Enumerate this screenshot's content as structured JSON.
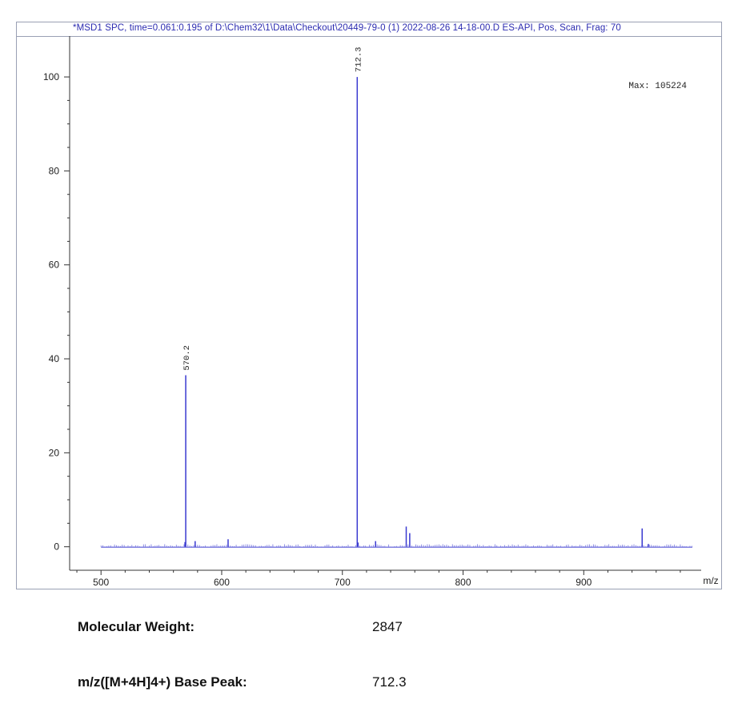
{
  "header": {
    "title": "*MSD1 SPC, time=0.061:0.195 of D:\\Chem32\\1\\Data\\Checkout\\20449-79-0 (1) 2022-08-26 14-18-00.D   ES-API, Pos, Scan, Frag: 70"
  },
  "max_label": "Max: 105224",
  "chart_data": {
    "type": "bar",
    "xlabel": "m/z",
    "ylabel": "",
    "xlim": [
      474,
      992
    ],
    "ylim": [
      -5,
      107
    ],
    "xticks": [
      500,
      600,
      700,
      800,
      900
    ],
    "yticks": [
      0,
      20,
      40,
      60,
      80,
      100
    ],
    "grid": false,
    "series": [
      {
        "x": [
          569.6,
          570.2,
          578.0,
          605.3,
          712.3,
          713.0,
          727.5,
          752.9,
          755.8,
          948.4,
          953.5
        ],
        "values": [
          1.0,
          36.5,
          1.2,
          1.6,
          100.0,
          0.9,
          1.2,
          4.3,
          2.9,
          3.9,
          0.6
        ]
      }
    ],
    "peak_labels": [
      {
        "x": 570.2,
        "label": "570.2"
      },
      {
        "x": 712.3,
        "label": "712.3"
      }
    ]
  },
  "info": {
    "molecular_weight_label": "Molecular Weight:",
    "molecular_weight_value": "2847",
    "base_peak_label": "m/z([M+4H]4+) Base Peak:",
    "base_peak_value": "712.3"
  }
}
